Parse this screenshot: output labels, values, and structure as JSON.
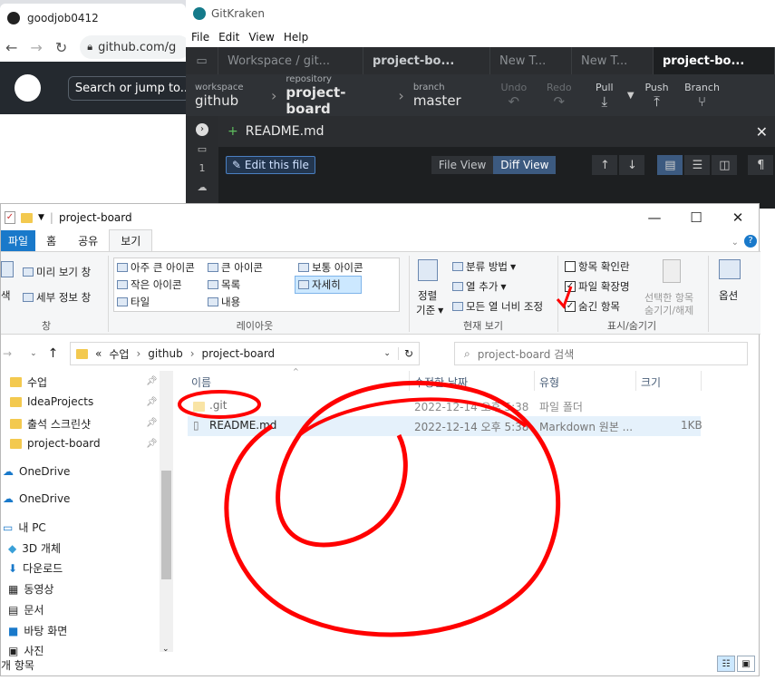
{
  "browser": {
    "tab_title": "goodjob0412",
    "url": "github.com/g",
    "search_placeholder": "Search or jump to..."
  },
  "gitkraken": {
    "window_title": "GitKraken",
    "menu": [
      "File",
      "Edit",
      "View",
      "Help"
    ],
    "tabs": [
      "Workspace / git...",
      "project-bo...",
      "New T...",
      "New T...",
      "project-bo..."
    ],
    "toolbar": {
      "workspace_label": "workspace",
      "workspace_value": "github",
      "repository_label": "repository",
      "repository_value": "project-board",
      "branch_label": "branch",
      "branch_value": "master",
      "undo": "Undo",
      "redo": "Redo",
      "pull": "Pull",
      "push": "Push",
      "branch_btn": "Branch"
    },
    "sidebar_count": "1",
    "file_name": "README.md",
    "edit_file": "Edit this file",
    "file_view": "File View",
    "diff_view": "Diff View"
  },
  "explorer": {
    "title": "project-board",
    "ribbon_tabs": [
      "파일",
      "홈",
      "공유",
      "보기"
    ],
    "pane_items": [
      "미리 보기 창",
      "세부 정보 창"
    ],
    "pane_left_label": "색",
    "pane_group": "창",
    "layout": {
      "items": [
        "아주 큰 아이콘",
        "큰 아이콘",
        "보통 아이콘",
        "작은 아이콘",
        "목록",
        "자세히",
        "타일",
        "내용"
      ],
      "group": "레이아웃"
    },
    "current_view": {
      "sort_label": "정렬",
      "sort_sub": "기준",
      "group_by": "분류 방법",
      "add_column": "열 추가",
      "fit_columns": "모든 열 너비 조정",
      "group": "현재 보기"
    },
    "show_hide": {
      "item_checkbox": "항목 확인란",
      "file_ext": "파일 확장명",
      "hidden_items": "숨긴 항목",
      "hide_selected": "선택한 항목",
      "hide_selected2": "숨기기/해제",
      "group": "표시/숨기기"
    },
    "options": "옵션",
    "address": {
      "prefix": "«",
      "parts": [
        "수업",
        "github",
        "project-board"
      ],
      "search_placeholder": "project-board 검색"
    },
    "nav": [
      "수업",
      "IdeaProjects",
      "출석 스크린샷",
      "project-board",
      "OneDrive",
      "OneDrive",
      "내 PC",
      "3D 개체",
      "다운로드",
      "동영상",
      "문서",
      "바탕 화면",
      "사진"
    ],
    "columns": [
      "이름",
      "수정한 날짜",
      "유형",
      "크기"
    ],
    "files": [
      {
        "name": ".git",
        "date": "2022-12-14 오후 5:38",
        "type": "파일 폴더",
        "size": ""
      },
      {
        "name": "README.md",
        "date": "2022-12-14 오후 5:38",
        "type": "Markdown 원본 ...",
        "size": "1KB"
      }
    ],
    "status": "개 항목"
  }
}
